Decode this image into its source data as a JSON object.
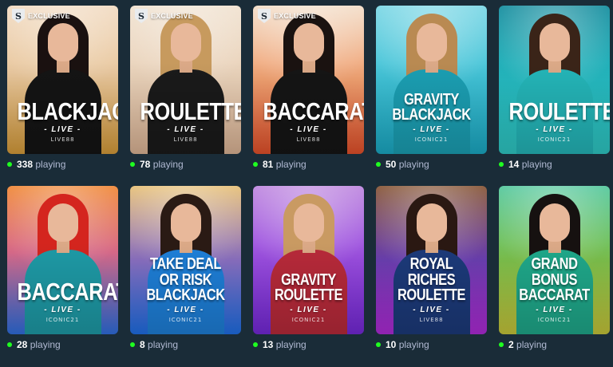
{
  "colors": {
    "background": "#1a2c38",
    "online_dot": "#1fff20",
    "meta_text": "#b1bad3"
  },
  "games": [
    {
      "title1": "BLACKJACK",
      "title2": "",
      "size": "big",
      "live": "LIVE",
      "provider": "LIVE88",
      "exclusive": true,
      "badge_letter": "S",
      "badge_label": "EXCLUSIVE",
      "players": "338",
      "players_label": "playing",
      "bg": "linear-gradient(180deg,#f2dcc4 0%,#e9c89f 45%,#d79c3a 100%)",
      "hair": "#1a1110",
      "outfit": "#141414"
    },
    {
      "title1": "ROULETTE",
      "title2": "",
      "size": "big",
      "live": "LIVE",
      "provider": "LIVE88",
      "exclusive": true,
      "badge_letter": "S",
      "badge_label": "EXCLUSIVE",
      "players": "78",
      "players_label": "playing",
      "bg": "linear-gradient(180deg,#f1e3d2 0%,#e9d1b8 50%,#dcb495 100%)",
      "hair": "#c79a5e",
      "outfit": "#1a1a1a"
    },
    {
      "title1": "BACCARAT",
      "title2": "",
      "size": "big",
      "live": "LIVE",
      "provider": "LIVE88",
      "exclusive": true,
      "badge_letter": "S",
      "badge_label": "EXCLUSIVE",
      "players": "81",
      "players_label": "playing",
      "bg": "linear-gradient(180deg,#f3dfcb 0%,#f0a070 50%,#e4502a 100%)",
      "hair": "#1a1210",
      "outfit": "#151515"
    },
    {
      "title1": "GRAVITY",
      "title2": "BLACKJACK",
      "size": "small",
      "live": "LIVE",
      "provider": "ICONIC21",
      "exclusive": false,
      "players": "50",
      "players_label": "playing",
      "bg": "linear-gradient(180deg,#7fd8e6 0%,#40c2d6 50%,#1aa9c4 100%)",
      "hair": "#b98a52",
      "outfit": "#1b9fb3"
    },
    {
      "title1": "ROULETTE",
      "title2": "",
      "size": "big",
      "live": "LIVE",
      "provider": "ICONIC21",
      "exclusive": false,
      "players": "14",
      "players_label": "playing",
      "bg": "linear-gradient(180deg,#1a8fa0 0%,#25b9c0 50%,#2fc8c4 100%)",
      "hair": "#3a2418",
      "outfit": "#24b5b8"
    },
    {
      "title1": "BACCARAT",
      "title2": "",
      "size": "big",
      "live": "LIVE",
      "provider": "ICONIC21",
      "exclusive": false,
      "players": "28",
      "players_label": "playing",
      "bg": "linear-gradient(180deg,#f08a3a 0%,#d86a8a 45%,#2f6fe0 100%)",
      "hair": "#d4251e",
      "outfit": "#1e9aa6"
    },
    {
      "title1": "TAKE DEAL OR RISK",
      "title2": "BLACKJACK",
      "size": "small",
      "live": "LIVE",
      "provider": "ICONIC21",
      "exclusive": false,
      "players": "8",
      "players_label": "playing",
      "bg": "linear-gradient(180deg,#e8c27a 0%,#8a6fc0 50%,#1e6fe6 100%)",
      "hair": "#2a1a14",
      "outfit": "#1e7fd8"
    },
    {
      "title1": "GRAVITY",
      "title2": "ROULETTE",
      "size": "small",
      "live": "LIVE",
      "provider": "ICONIC21",
      "exclusive": false,
      "players": "13",
      "players_label": "playing",
      "bg": "linear-gradient(180deg,#c08be0 0%,#9a4de0 50%,#7428d8 100%)",
      "hair": "#c99a62",
      "outfit": "#b82a3a"
    },
    {
      "title1": "ROYAL RICHES",
      "title2": "ROULETTE",
      "size": "small",
      "live": "LIVE",
      "provider": "LIVE88",
      "exclusive": false,
      "players": "10",
      "players_label": "playing",
      "bg": "linear-gradient(180deg,#8a5a3a 0%,#6a3fb0 50%,#b02ad8 100%)",
      "hair": "#2a1812",
      "outfit": "#1c3a7a"
    },
    {
      "title1": "GRAND BONUS",
      "title2": "BACCARAT",
      "size": "small",
      "live": "LIVE",
      "provider": "ICONIC21",
      "exclusive": false,
      "players": "2",
      "players_label": "playing",
      "bg": "linear-gradient(180deg,#58c9a0 0%,#7cc04c 50%,#c8c63a 100%)",
      "hair": "#161110",
      "outfit": "#1fa88a"
    }
  ]
}
